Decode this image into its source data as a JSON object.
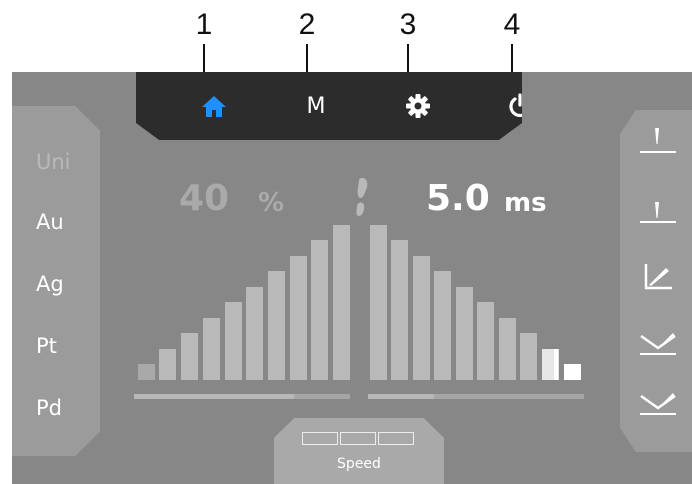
{
  "callouts": [
    "1",
    "2",
    "3",
    "4"
  ],
  "topbar": {
    "items": [
      {
        "id": "home",
        "icon": "home-icon",
        "active": true
      },
      {
        "id": "memory",
        "label": "M"
      },
      {
        "id": "settings",
        "icon": "gear-icon"
      },
      {
        "id": "power",
        "icon": "power-icon"
      }
    ],
    "active_color": "#1e90ff"
  },
  "materials": [
    "Uni",
    "Au",
    "Ag",
    "Pt",
    "Pd"
  ],
  "power": {
    "value": "40",
    "unit": "%",
    "level_bars": 14,
    "level_max": 14
  },
  "pulse": {
    "value": "5.0",
    "unit": "ms"
  },
  "speed": {
    "label": "Speed",
    "segments": 3
  },
  "modes": [
    "tip-mode-1",
    "tip-mode-2",
    "angle-mode",
    "v-mode-1",
    "v-mode-2"
  ]
}
